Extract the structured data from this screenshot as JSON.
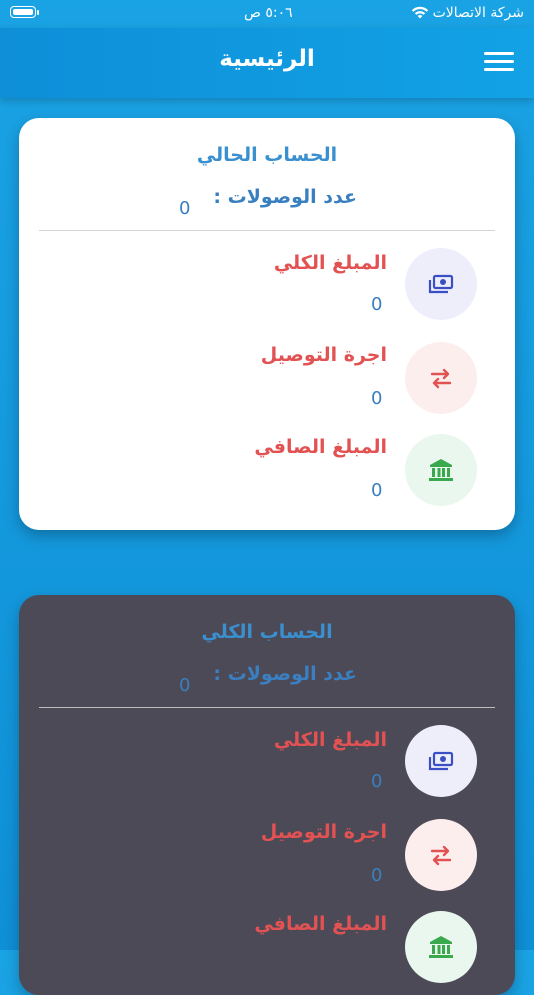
{
  "status_bar": {
    "carrier": "شركة الاتصالات",
    "time": "٥:٠٦ ص"
  },
  "header": {
    "title": "الرئيسية"
  },
  "current_account": {
    "title": "الحساب الحالي",
    "receipts_label": "عدد الوصولات :",
    "receipts_value": "0",
    "rows": [
      {
        "label": "المبلغ الكلي",
        "value": "0",
        "icon": "money-icon"
      },
      {
        "label": "اجرة التوصيل",
        "value": "0",
        "icon": "transfer-icon"
      },
      {
        "label": "المبلغ الصافي",
        "value": "0",
        "icon": "bank-icon"
      }
    ]
  },
  "total_account": {
    "title": "الحساب الكلي",
    "receipts_label": "عدد الوصولات :",
    "receipts_value": "0",
    "rows": [
      {
        "label": "المبلغ الكلي",
        "value": "0",
        "icon": "money-icon"
      },
      {
        "label": "اجرة التوصيل",
        "value": "0",
        "icon": "transfer-icon"
      },
      {
        "label": "المبلغ الصافي",
        "value": "",
        "icon": "bank-icon"
      }
    ]
  },
  "colors": {
    "primary": "#1aa3e4",
    "label_red": "#e35252",
    "value_blue": "#3a7fbf",
    "dark_card": "#4d4a57",
    "money_icon": "#3b4fc4",
    "transfer_icon": "#e35252",
    "bank_icon": "#3aa84c"
  }
}
